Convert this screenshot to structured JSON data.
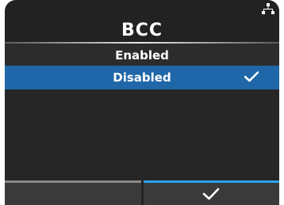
{
  "screen": {
    "title": "BCC",
    "status_icon": "network-icon"
  },
  "options": [
    {
      "label": "Enabled",
      "selected": false
    },
    {
      "label": "Disabled",
      "selected": true
    }
  ],
  "softkeys": {
    "left": {
      "icon": "none"
    },
    "right": {
      "icon": "check-icon"
    }
  },
  "colors": {
    "panel": "#222222",
    "selected_row": "#1f67a8",
    "accent": "#2aa4f0"
  }
}
